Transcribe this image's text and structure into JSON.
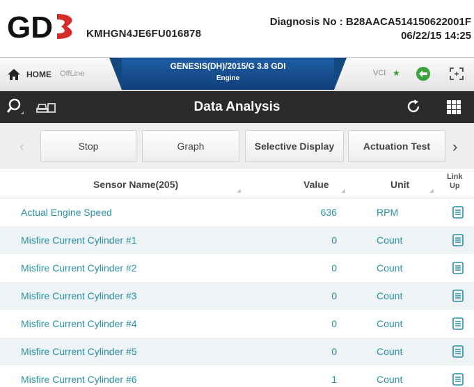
{
  "header": {
    "logo_text": "GDS",
    "vin": "KMHGN4JE6FU016878",
    "diagnosis": "Diagnosis No : B28AACA514150622001F",
    "datetime": "06/22/15 14:25"
  },
  "navbar": {
    "home_label": "HOME",
    "offline_label": "OffLine",
    "vehicle_title": "GENESIS(DH)/2015/G 3.8 GDI",
    "vehicle_system": "Engine",
    "vci_label": "VCI"
  },
  "toolbar": {
    "title": "Data Analysis"
  },
  "buttons": {
    "stop": "Stop",
    "graph": "Graph",
    "selective": "Selective Display",
    "actuation": "Actuation Test"
  },
  "table": {
    "headers": {
      "name": "Sensor Name(205)",
      "value": "Value",
      "unit": "Unit",
      "link_line1": "Link",
      "link_line2": "Up"
    },
    "rows": [
      {
        "name": "Actual Engine Speed",
        "value": "636",
        "unit": "RPM"
      },
      {
        "name": "Misfire Current Cylinder #1",
        "value": "0",
        "unit": "Count"
      },
      {
        "name": "Misfire Current Cylinder #2",
        "value": "0",
        "unit": "Count"
      },
      {
        "name": "Misfire Current Cylinder #3",
        "value": "0",
        "unit": "Count"
      },
      {
        "name": "Misfire Current Cylinder #4",
        "value": "0",
        "unit": "Count"
      },
      {
        "name": "Misfire Current Cylinder #5",
        "value": "0",
        "unit": "Count"
      },
      {
        "name": "Misfire Current Cylinder #6",
        "value": "1",
        "unit": "Count"
      }
    ]
  },
  "colors": {
    "brand_red": "#d62b2b",
    "nav_blue": "#14497f",
    "toolbar_dark": "#2b2b2b",
    "row_text": "#2a8fa3",
    "row_alt": "#eef3f6"
  }
}
